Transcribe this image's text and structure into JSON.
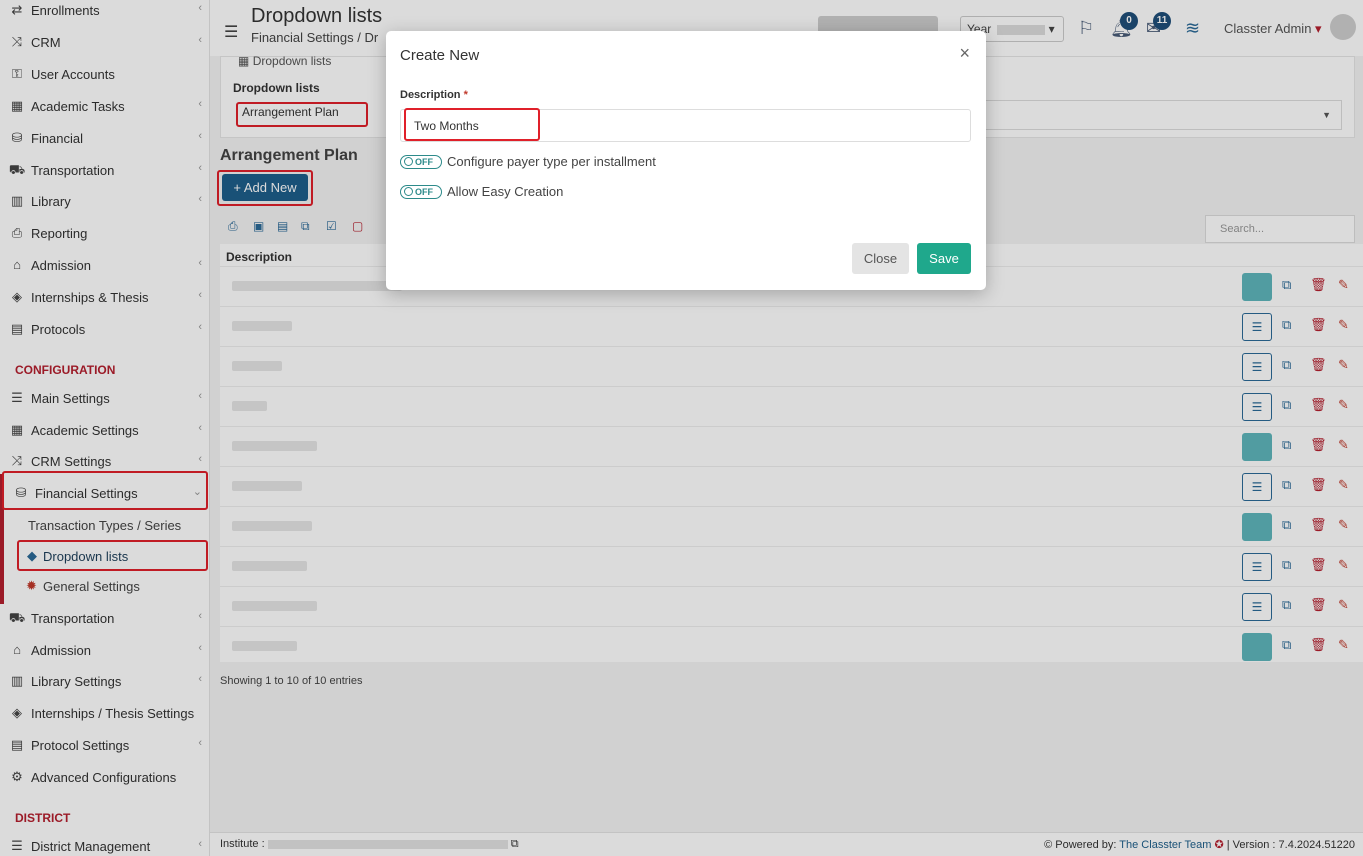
{
  "sidebar": {
    "top_items": [
      {
        "label": "Enrollments",
        "icon": "swap-icon"
      },
      {
        "label": "CRM",
        "icon": "shuffle-icon"
      },
      {
        "label": "User Accounts",
        "icon": "key-icon"
      },
      {
        "label": "Academic Tasks",
        "icon": "grid-icon"
      },
      {
        "label": "Financial",
        "icon": "coins-icon"
      },
      {
        "label": "Transportation",
        "icon": "bus-icon"
      },
      {
        "label": "Library",
        "icon": "books-icon"
      },
      {
        "label": "Reporting",
        "icon": "printer-icon"
      },
      {
        "label": "Admission",
        "icon": "building-icon"
      },
      {
        "label": "Internships & Thesis",
        "icon": "box-icon"
      },
      {
        "label": "Protocols",
        "icon": "cabinet-icon"
      }
    ],
    "section_config": "CONFIGURATION",
    "config_items": [
      {
        "label": "Main Settings",
        "icon": "sliders-icon"
      },
      {
        "label": "Academic Settings",
        "icon": "grid-icon"
      },
      {
        "label": "CRM Settings",
        "icon": "shuffle-icon"
      },
      {
        "label": "Financial Settings",
        "icon": "coins-icon"
      }
    ],
    "sub_items": [
      {
        "label": "Transaction Types / Series"
      },
      {
        "label": "Dropdown lists",
        "icon": "layers-icon"
      },
      {
        "label": "General Settings",
        "icon": "gear-icon"
      }
    ],
    "config_items_2": [
      {
        "label": "Transportation",
        "icon": "bus-icon"
      },
      {
        "label": "Admission",
        "icon": "building-icon"
      },
      {
        "label": "Library Settings",
        "icon": "books-icon"
      },
      {
        "label": "Internships / Thesis Settings",
        "icon": "box-icon"
      },
      {
        "label": "Protocol Settings",
        "icon": "cabinet-icon"
      },
      {
        "label": "Advanced Configurations",
        "icon": "gears-icon"
      }
    ],
    "section_district": "DISTRICT",
    "district_items": [
      {
        "label": "District Management",
        "icon": "list-icon"
      }
    ]
  },
  "header": {
    "title": "Dropdown lists",
    "breadcrumb": "Financial Settings /  Dr",
    "year_label": "Year",
    "notifications_count": "0",
    "messages_count": "11",
    "user_name": "Classter Admin"
  },
  "filter": {
    "tab_label": "Dropdown lists",
    "label": "Dropdown lists",
    "value": "Arrangement Plan"
  },
  "list": {
    "section_title": "Arrangement Plan",
    "add_button": "+ Add New",
    "search_placeholder": "Search...",
    "column_description": "Description",
    "showing": "Showing 1 to 10 of 10 entries"
  },
  "footer": {
    "institute_label": "Institute : ",
    "powered_by": "Powered by:",
    "team": "The Classter Team",
    "version": "| Version : 7.4.2024.51220"
  },
  "modal": {
    "title": "Create New",
    "close_x": "×",
    "description_label": "Description",
    "required_mark": "*",
    "description_value": "Two Months",
    "toggle_off": "OFF",
    "option_1": "Configure payer type per installment",
    "option_2": "Allow Easy Creation",
    "close_button": "Close",
    "save_button": "Save"
  },
  "colors": {
    "accent_red": "#b51f2e",
    "primary_blue": "#1e5f8b",
    "save_green": "#1fa88c",
    "teal_action": "#5fb6bc"
  }
}
